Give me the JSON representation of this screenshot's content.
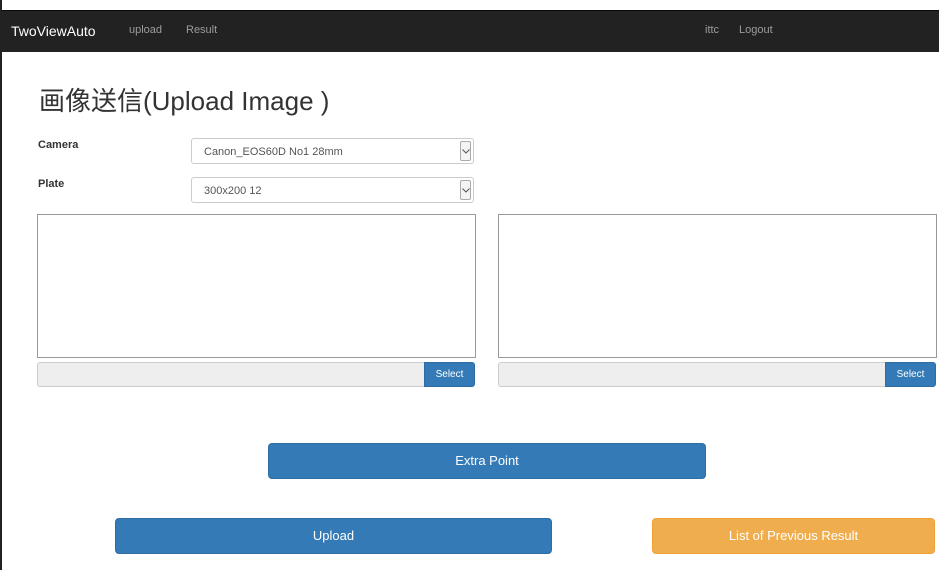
{
  "navbar": {
    "brand": "TwoViewAuto",
    "links": [
      "upload",
      "Result"
    ],
    "user": "ittc",
    "logout": "Logout"
  },
  "page": {
    "title": "画像送信(Upload Image )"
  },
  "form": {
    "camera_label": "Camera",
    "camera_value": "Canon_EOS60D No1 28mm",
    "plate_label": "Plate",
    "plate_value": "300x200 12"
  },
  "image_panels": {
    "left_select_label": "Select",
    "right_select_label": "Select"
  },
  "buttons": {
    "extra_point": "Extra Point",
    "upload": "Upload",
    "list_previous": "List of Previous Result"
  },
  "colors": {
    "navbar_bg": "#222222",
    "primary": "#337ab7",
    "warning": "#f0ad4e"
  },
  "icons": {
    "select_arrow": "chevron-down-icon"
  }
}
